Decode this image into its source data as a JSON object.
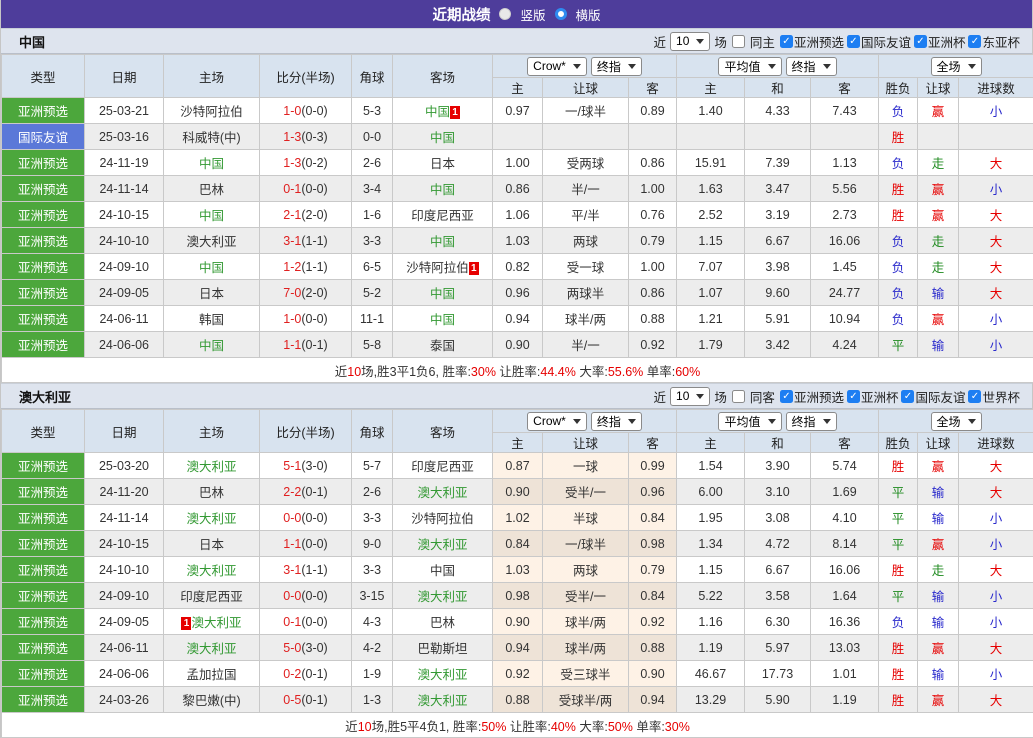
{
  "title": {
    "text": "近期战绩",
    "vertical_label": "竖版",
    "horizontal_label": "横版"
  },
  "table_header": {
    "selects": {
      "bookmaker": "Crow*",
      "final1": "终指",
      "average": "平均值",
      "final2": "终指",
      "fulltime": "全场"
    },
    "cols": {
      "type": "类型",
      "date": "日期",
      "home": "主场",
      "score": "比分(半场)",
      "corner": "角球",
      "away": "客场",
      "h_home": "主",
      "h_line": "让球",
      "h_away": "客",
      "a_home": "主",
      "a_draw": "和",
      "a_away": "客",
      "r_wl": "胜负",
      "r_handicap": "让球",
      "r_goals": "进球数"
    }
  },
  "sections": [
    {
      "team": "中国",
      "odds_tint": false,
      "filter": {
        "prefix": "近",
        "count": "10",
        "suffix": "场",
        "same": "同主",
        "leagues": [
          "亚洲预选",
          "国际友谊",
          "亚洲杯",
          "东亚杯"
        ]
      },
      "rows": [
        {
          "type": "亚洲预选",
          "type_color": "green",
          "date": "25-03-21",
          "home": "沙特阿拉伯",
          "home_track": false,
          "score": "1-0",
          "half": "(0-0)",
          "corner": "5-3",
          "away": "中国",
          "away_track": true,
          "away_badge": "1",
          "away_badge_pos": "after",
          "odds": [
            "0.97",
            "一/球半",
            "0.89"
          ],
          "avg": [
            "1.40",
            "4.33",
            "7.43"
          ],
          "res": [
            "负",
            "赢",
            "小"
          ]
        },
        {
          "type": "国际友谊",
          "type_color": "blue",
          "date": "25-03-16",
          "home": "科威特(中)",
          "home_track": false,
          "score": "1-3",
          "half": "(0-3)",
          "corner": "0-0",
          "away": "中国",
          "away_track": true,
          "odds": [
            "",
            "",
            ""
          ],
          "avg": [
            "",
            "",
            ""
          ],
          "res": [
            "胜",
            "",
            ""
          ]
        },
        {
          "type": "亚洲预选",
          "type_color": "green",
          "date": "24-11-19",
          "home": "中国",
          "home_track": true,
          "score": "1-3",
          "half": "(0-2)",
          "corner": "2-6",
          "away": "日本",
          "away_track": false,
          "odds": [
            "1.00",
            "受两球",
            "0.86"
          ],
          "avg": [
            "15.91",
            "7.39",
            "1.13"
          ],
          "res": [
            "负",
            "走",
            "大"
          ]
        },
        {
          "type": "亚洲预选",
          "type_color": "green",
          "date": "24-11-14",
          "home": "巴林",
          "home_track": false,
          "score": "0-1",
          "half": "(0-0)",
          "corner": "3-4",
          "away": "中国",
          "away_track": true,
          "odds": [
            "0.86",
            "半/一",
            "1.00"
          ],
          "avg": [
            "1.63",
            "3.47",
            "5.56"
          ],
          "res": [
            "胜",
            "赢",
            "小"
          ]
        },
        {
          "type": "亚洲预选",
          "type_color": "green",
          "date": "24-10-15",
          "home": "中国",
          "home_track": true,
          "score": "2-1",
          "half": "(2-0)",
          "corner": "1-6",
          "away": "印度尼西亚",
          "away_track": false,
          "odds": [
            "1.06",
            "平/半",
            "0.76"
          ],
          "avg": [
            "2.52",
            "3.19",
            "2.73"
          ],
          "res": [
            "胜",
            "赢",
            "大"
          ]
        },
        {
          "type": "亚洲预选",
          "type_color": "green",
          "date": "24-10-10",
          "home": "澳大利亚",
          "home_track": false,
          "score": "3-1",
          "half": "(1-1)",
          "corner": "3-3",
          "away": "中国",
          "away_track": true,
          "odds": [
            "1.03",
            "两球",
            "0.79"
          ],
          "avg": [
            "1.15",
            "6.67",
            "16.06"
          ],
          "res": [
            "负",
            "走",
            "大"
          ]
        },
        {
          "type": "亚洲预选",
          "type_color": "green",
          "date": "24-09-10",
          "home": "中国",
          "home_track": true,
          "score": "1-2",
          "half": "(1-1)",
          "corner": "6-5",
          "away": "沙特阿拉伯",
          "away_track": false,
          "away_badge": "1",
          "away_badge_pos": "after",
          "odds": [
            "0.82",
            "受一球",
            "1.00"
          ],
          "avg": [
            "7.07",
            "3.98",
            "1.45"
          ],
          "res": [
            "负",
            "走",
            "大"
          ]
        },
        {
          "type": "亚洲预选",
          "type_color": "green",
          "date": "24-09-05",
          "home": "日本",
          "home_track": false,
          "score": "7-0",
          "half": "(2-0)",
          "corner": "5-2",
          "away": "中国",
          "away_track": true,
          "odds": [
            "0.96",
            "两球半",
            "0.86"
          ],
          "avg": [
            "1.07",
            "9.60",
            "24.77"
          ],
          "res": [
            "负",
            "输",
            "大"
          ]
        },
        {
          "type": "亚洲预选",
          "type_color": "green",
          "date": "24-06-11",
          "home": "韩国",
          "home_track": false,
          "score": "1-0",
          "half": "(0-0)",
          "corner": "11-1",
          "away": "中国",
          "away_track": true,
          "odds": [
            "0.94",
            "球半/两",
            "0.88"
          ],
          "avg": [
            "1.21",
            "5.91",
            "10.94"
          ],
          "res": [
            "负",
            "赢",
            "小"
          ]
        },
        {
          "type": "亚洲预选",
          "type_color": "green",
          "date": "24-06-06",
          "home": "中国",
          "home_track": true,
          "score": "1-1",
          "half": "(0-1)",
          "corner": "5-8",
          "away": "泰国",
          "away_track": false,
          "odds": [
            "0.90",
            "半/一",
            "0.92"
          ],
          "avg": [
            "1.79",
            "3.42",
            "4.24"
          ],
          "res": [
            "平",
            "输",
            "小"
          ]
        }
      ],
      "summary": [
        "近",
        "10",
        "场,胜3平1负6, 胜率:",
        "30%",
        " 让胜率:",
        "44.4%",
        " 大率:",
        "55.6%",
        " 单率:",
        "60%"
      ]
    },
    {
      "team": "澳大利亚",
      "odds_tint": true,
      "filter": {
        "prefix": "近",
        "count": "10",
        "suffix": "场",
        "same": "同客",
        "leagues": [
          "亚洲预选",
          "亚洲杯",
          "国际友谊",
          "世界杯"
        ]
      },
      "rows": [
        {
          "type": "亚洲预选",
          "type_color": "green",
          "date": "25-03-20",
          "home": "澳大利亚",
          "home_track": true,
          "score": "5-1",
          "half": "(3-0)",
          "corner": "5-7",
          "away": "印度尼西亚",
          "away_track": false,
          "odds": [
            "0.87",
            "一球",
            "0.99"
          ],
          "avg": [
            "1.54",
            "3.90",
            "5.74"
          ],
          "res": [
            "胜",
            "赢",
            "大"
          ]
        },
        {
          "type": "亚洲预选",
          "type_color": "green",
          "date": "24-11-20",
          "home": "巴林",
          "home_track": false,
          "score": "2-2",
          "half": "(0-1)",
          "corner": "2-6",
          "away": "澳大利亚",
          "away_track": true,
          "odds": [
            "0.90",
            "受半/一",
            "0.96"
          ],
          "avg": [
            "6.00",
            "3.10",
            "1.69"
          ],
          "res": [
            "平",
            "输",
            "大"
          ]
        },
        {
          "type": "亚洲预选",
          "type_color": "green",
          "date": "24-11-14",
          "home": "澳大利亚",
          "home_track": true,
          "score": "0-0",
          "half": "(0-0)",
          "corner": "3-3",
          "away": "沙特阿拉伯",
          "away_track": false,
          "odds": [
            "1.02",
            "半球",
            "0.84"
          ],
          "avg": [
            "1.95",
            "3.08",
            "4.10"
          ],
          "res": [
            "平",
            "输",
            "小"
          ]
        },
        {
          "type": "亚洲预选",
          "type_color": "green",
          "date": "24-10-15",
          "home": "日本",
          "home_track": false,
          "score": "1-1",
          "half": "(0-0)",
          "corner": "9-0",
          "away": "澳大利亚",
          "away_track": true,
          "odds": [
            "0.84",
            "一/球半",
            "0.98"
          ],
          "avg": [
            "1.34",
            "4.72",
            "8.14"
          ],
          "res": [
            "平",
            "赢",
            "小"
          ]
        },
        {
          "type": "亚洲预选",
          "type_color": "green",
          "date": "24-10-10",
          "home": "澳大利亚",
          "home_track": true,
          "score": "3-1",
          "half": "(1-1)",
          "corner": "3-3",
          "away": "中国",
          "away_track": false,
          "odds": [
            "1.03",
            "两球",
            "0.79"
          ],
          "avg": [
            "1.15",
            "6.67",
            "16.06"
          ],
          "res": [
            "胜",
            "走",
            "大"
          ]
        },
        {
          "type": "亚洲预选",
          "type_color": "green",
          "date": "24-09-10",
          "home": "印度尼西亚",
          "home_track": false,
          "score": "0-0",
          "half": "(0-0)",
          "corner": "3-15",
          "away": "澳大利亚",
          "away_track": true,
          "odds": [
            "0.98",
            "受半/一",
            "0.84"
          ],
          "avg": [
            "5.22",
            "3.58",
            "1.64"
          ],
          "res": [
            "平",
            "输",
            "小"
          ]
        },
        {
          "type": "亚洲预选",
          "type_color": "green",
          "date": "24-09-05",
          "home": "澳大利亚",
          "home_track": true,
          "home_badge": "1",
          "home_badge_pos": "before",
          "score": "0-1",
          "half": "(0-0)",
          "corner": "4-3",
          "away": "巴林",
          "away_track": false,
          "odds": [
            "0.90",
            "球半/两",
            "0.92"
          ],
          "avg": [
            "1.16",
            "6.30",
            "16.36"
          ],
          "res": [
            "负",
            "输",
            "小"
          ]
        },
        {
          "type": "亚洲预选",
          "type_color": "green",
          "date": "24-06-11",
          "home": "澳大利亚",
          "home_track": true,
          "score": "5-0",
          "half": "(3-0)",
          "corner": "4-2",
          "away": "巴勒斯坦",
          "away_track": false,
          "odds": [
            "0.94",
            "球半/两",
            "0.88"
          ],
          "avg": [
            "1.19",
            "5.97",
            "13.03"
          ],
          "res": [
            "胜",
            "赢",
            "大"
          ]
        },
        {
          "type": "亚洲预选",
          "type_color": "green",
          "date": "24-06-06",
          "home": "孟加拉国",
          "home_track": false,
          "score": "0-2",
          "half": "(0-1)",
          "corner": "1-9",
          "away": "澳大利亚",
          "away_track": true,
          "odds": [
            "0.92",
            "受三球半",
            "0.90"
          ],
          "avg": [
            "46.67",
            "17.73",
            "1.01"
          ],
          "res": [
            "胜",
            "输",
            "小"
          ]
        },
        {
          "type": "亚洲预选",
          "type_color": "green",
          "date": "24-03-26",
          "home": "黎巴嫩(中)",
          "home_track": false,
          "score": "0-5",
          "half": "(0-1)",
          "corner": "1-3",
          "away": "澳大利亚",
          "away_track": true,
          "odds": [
            "0.88",
            "受球半/两",
            "0.94"
          ],
          "avg": [
            "13.29",
            "5.90",
            "1.19"
          ],
          "res": [
            "胜",
            "赢",
            "大"
          ]
        }
      ],
      "summary": [
        "近",
        "10",
        "场,胜5平4负1, 胜率:",
        "50%",
        " 让胜率:",
        "40%",
        " 大率:",
        "50%",
        " 单率:",
        "30%"
      ]
    }
  ],
  "colors": {
    "title_bar": "#4e3d9b",
    "type_green": "#4ca73c",
    "type_blue": "#5b78d8",
    "win_red": "#e60000",
    "draw_green": "#1f8a1f",
    "lose_blue": "#2929cc",
    "score_red": "#e02020",
    "tracked_team_green": "#339933",
    "checkbox_blue": "#1d7ef2"
  }
}
